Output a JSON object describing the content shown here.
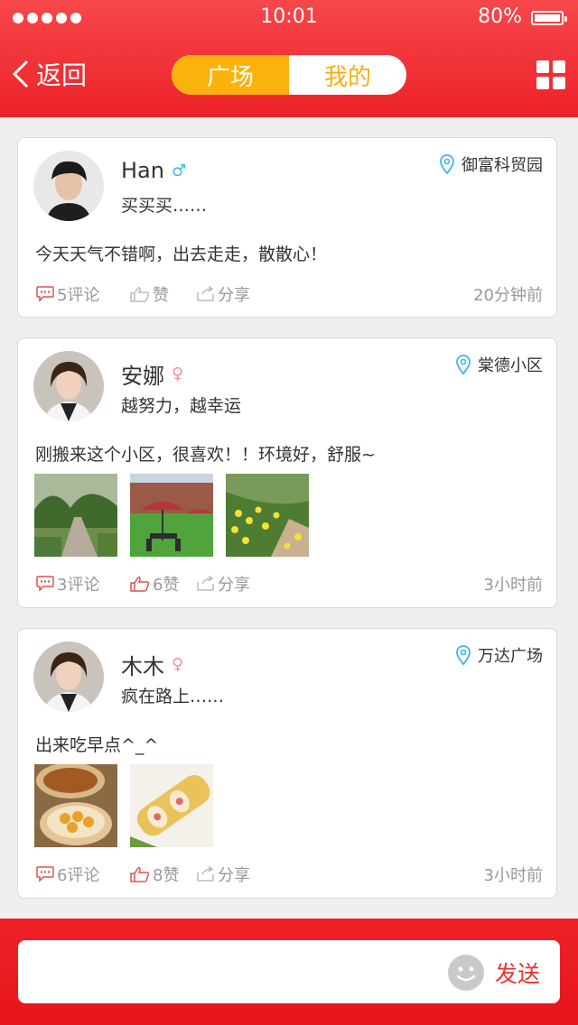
{
  "status_bar": {
    "time": "10:01",
    "battery": "80%"
  },
  "nav": {
    "back_label": "返回",
    "tabs": [
      {
        "label": "广场",
        "active": true
      },
      {
        "label": "我的",
        "active": false
      }
    ],
    "menu_icon": "grid-icon"
  },
  "posts": [
    {
      "name": "Han",
      "gender_symbol": "♂",
      "signature": "买买买……",
      "location": "御富科贸园",
      "content": "今天天气不错啊，出去走走，散散心！",
      "comments": "5评论",
      "likes": "赞",
      "share": "分享",
      "time_ago": "20分钟前",
      "liked": false,
      "photos": []
    },
    {
      "name": "安娜",
      "gender_symbol": "♀",
      "signature": "越努力，越幸运",
      "location": "棠德小区",
      "content": "刚搬来这个小区，很喜欢！！环境好，舒服~",
      "comments": "3评论",
      "likes": "6赞",
      "share": "分享",
      "time_ago": "3小时前",
      "liked": true,
      "photos": [
        "garden-path-photo",
        "patio-umbrella-photo",
        "flower-bed-photo"
      ]
    },
    {
      "name": "木木",
      "gender_symbol": "♀",
      "signature": "疯在路上……",
      "location": "万达广场",
      "content": "出来吃早点^_^",
      "comments": "6评论",
      "likes": "8赞",
      "share": "分享",
      "time_ago": "3小时前",
      "liked": true,
      "photos": [
        "dim-sum-photo",
        "sushi-roll-photo"
      ]
    }
  ],
  "composer": {
    "placeholder": "",
    "send_label": "发送",
    "emoji_icon": "emoji-icon"
  },
  "colors": {
    "header_red": "#ec2228",
    "tab_yellow": "#fcb20d",
    "location_blue": "#3ab6e6",
    "send_red": "#e83232"
  }
}
